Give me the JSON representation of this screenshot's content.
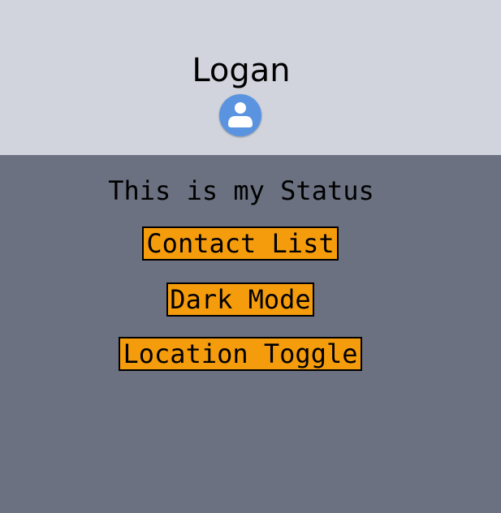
{
  "profile": {
    "name": "Logan",
    "avatar_icon": "user-avatar-icon"
  },
  "status": {
    "text": "This is my Status"
  },
  "buttons": {
    "contact_list": "Contact List",
    "dark_mode": "Dark Mode",
    "location_toggle": "Location Toggle"
  },
  "colors": {
    "header_bg": "#d1d4dd",
    "body_bg": "#6b7180",
    "button_bg": "#f59c0d",
    "avatar_bg": "#5a94e0"
  }
}
